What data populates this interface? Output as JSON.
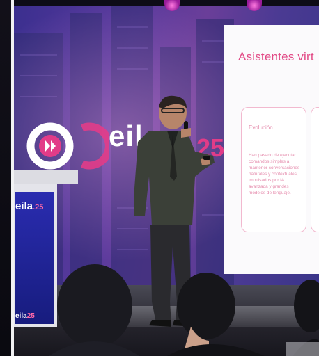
{
  "screen": {
    "logo_wordmark": "eil",
    "logo_year": "25"
  },
  "slide": {
    "title": "Asistentes virt",
    "card_heading": "Evolución",
    "card_body": "Han pasado de ejecutar comandos simples a mantener conversaciones naturales y contextuales, impulsados por IA avanzada y grandes modelos de lenguaje."
  },
  "podium": {
    "logo_main": "eila",
    "logo_year": ".25",
    "logo_bottom_main": "eila",
    "logo_bottom_year": "25"
  },
  "colors": {
    "brand_pink": "#e23c88",
    "screen_purple": "#4b3a93",
    "podium_blue": "#1f24a0"
  }
}
